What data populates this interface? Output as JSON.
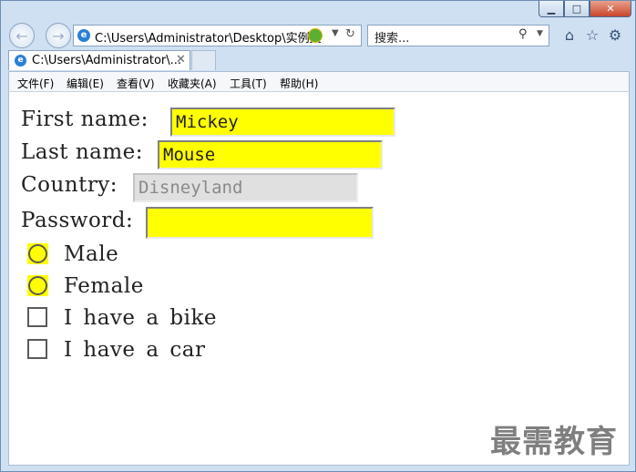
{
  "window": {
    "controls": {
      "minimize": "▁",
      "maximize": "□",
      "close": "✕"
    }
  },
  "nav": {
    "back_icon": "arrow-left-icon",
    "forward_icon": "arrow-right-icon",
    "address": "C:\\Users\\Administrator\\Desktop\\实例文",
    "search_placeholder": "搜索...",
    "toolbar_icons": [
      "home-icon",
      "favorites-star-icon",
      "settings-gear-icon"
    ]
  },
  "tab": {
    "title": "C:\\Users\\Administrator\\...",
    "close": "✕"
  },
  "menubar": {
    "items": [
      "文件(F)",
      "编辑(E)",
      "查看(V)",
      "收藏夹(A)",
      "工具(T)",
      "帮助(H)"
    ]
  },
  "form": {
    "first_name_label": "First name:",
    "first_name_value": "Mickey",
    "last_name_label": "Last name:",
    "last_name_value": "Mouse",
    "country_label": "Country:",
    "country_value": "Disneyland",
    "password_label": "Password:",
    "password_value": "",
    "radio_male": "Male",
    "radio_female": "Female",
    "check_bike": "I have a bike",
    "check_car": "I have a car",
    "field_highlight_color": "#ffff00",
    "disabled_field_color": "#e0e0e0"
  },
  "watermark": "最需教育"
}
